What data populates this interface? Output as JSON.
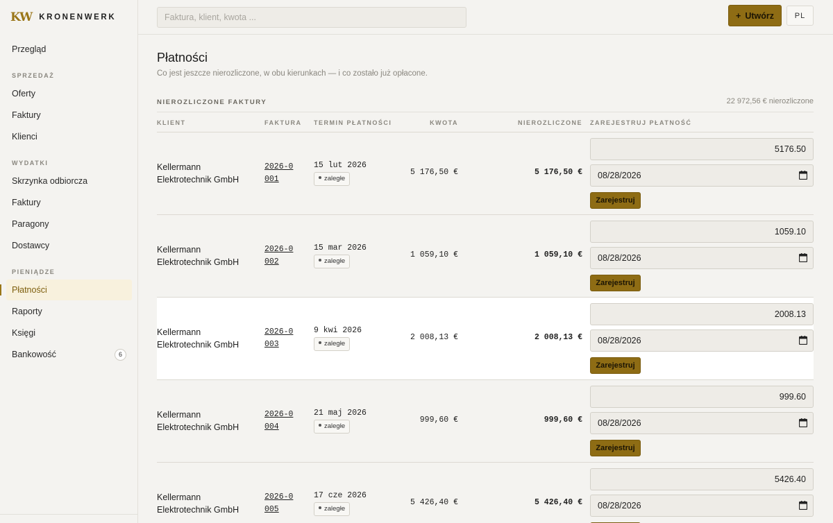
{
  "brand": {
    "mark": "KW",
    "name": "KRONENWERK"
  },
  "sidebar": {
    "overview": "Przegląd",
    "sales_title": "SPRZEDAŻ",
    "sales": [
      "Oferty",
      "Faktury",
      "Klienci"
    ],
    "expenses_title": "WYDATKI",
    "expenses": [
      "Skrzynka odbiorcza",
      "Faktury",
      "Paragony",
      "Dostawcy"
    ],
    "money_title": "PIENIĄDZE",
    "money": [
      "Płatności",
      "Raporty",
      "Księgi",
      "Bankowość"
    ],
    "banking_badge": "6",
    "active_item": "Płatności"
  },
  "topbar": {
    "search_placeholder": "Faktura, klient, kwota ...",
    "create_label": "Utwórz",
    "lang_label": "PL"
  },
  "page": {
    "title": "Płatności",
    "subtitle": "Co jest jeszcze nierozliczone, w obu kierunkach — i co zostało już opłacone."
  },
  "section": {
    "label": "NIEROZLICZONE FAKTURY",
    "total": "22 972,56 € nierozliczone"
  },
  "table": {
    "headers": {
      "client": "KLIENT",
      "invoice": "FAKTURA",
      "due": "TERMIN PŁATNOŚCI",
      "amount": "KWOTA",
      "outstanding": "NIEROZLICZONE",
      "register": "ZAREJESTRUJ PŁATNOŚĆ"
    },
    "register_button": "Zarejestruj",
    "rows": [
      {
        "client": "Kellermann Elektrotechnik GmbH",
        "invoice": "2026-0001",
        "due": "15 lut 2026",
        "status": "zaległe",
        "amount": "5 176,50 €",
        "outstanding": "5 176,50 €",
        "pay_amount": "5176.50",
        "pay_date": "08/28/2026"
      },
      {
        "client": "Kellermann Elektrotechnik GmbH",
        "invoice": "2026-0002",
        "due": "15 mar 2026",
        "status": "zaległe",
        "amount": "1 059,10 €",
        "outstanding": "1 059,10 €",
        "pay_amount": "1059.10",
        "pay_date": "08/28/2026"
      },
      {
        "client": "Kellermann Elektrotechnik GmbH",
        "invoice": "2026-0003",
        "due": "9 kwi 2026",
        "status": "zaległe",
        "amount": "2 008,13 €",
        "outstanding": "2 008,13 €",
        "pay_amount": "2008.13",
        "pay_date": "08/28/2026"
      },
      {
        "client": "Kellermann Elektrotechnik GmbH",
        "invoice": "2026-0004",
        "due": "21 maj 2026",
        "status": "zaległe",
        "amount": "999,60 €",
        "outstanding": "999,60 €",
        "pay_amount": "999.60",
        "pay_date": "08/28/2026"
      },
      {
        "client": "Kellermann Elektrotechnik GmbH",
        "invoice": "2026-0005",
        "due": "17 cze 2026",
        "status": "zaległe",
        "amount": "5 426,40 €",
        "outstanding": "5 426,40 €",
        "pay_amount": "5426.40",
        "pay_date": "08/28/2026"
      }
    ]
  }
}
